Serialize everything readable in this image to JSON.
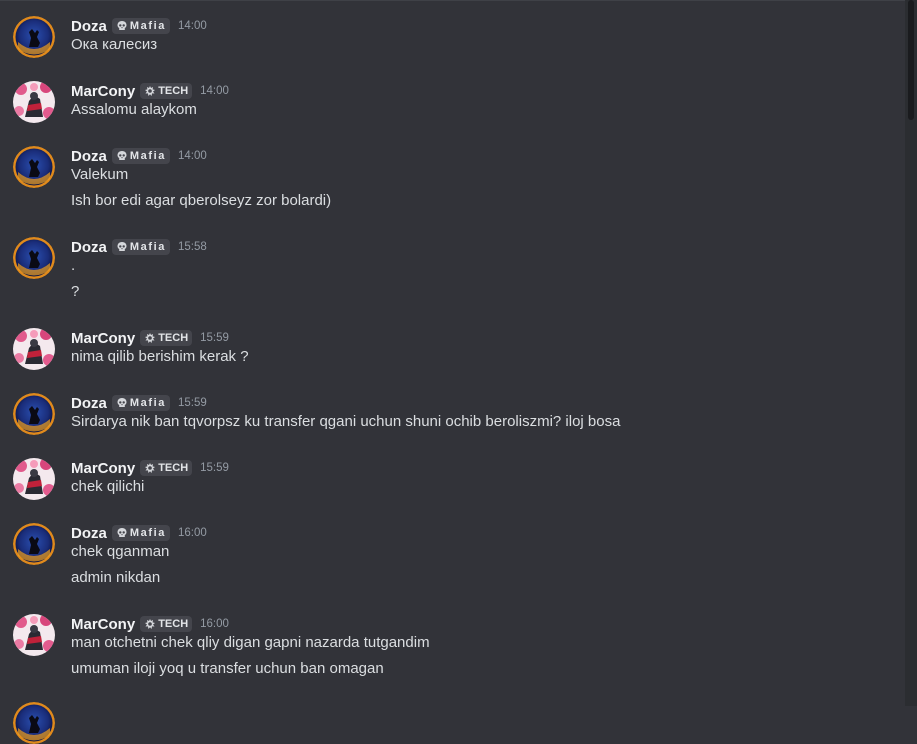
{
  "messages": [
    {
      "user": "Doza",
      "tag": "Mafia",
      "tag_icon": "skull-icon",
      "time": "14:00",
      "avatar": "doza",
      "lines": [
        "Ока калесиз"
      ]
    },
    {
      "user": "MarCony",
      "tag": "TECH",
      "tag_icon": "wrench-icon",
      "time": "14:00",
      "avatar": "marcony",
      "lines": [
        "Assalomu alaykom"
      ]
    },
    {
      "user": "Doza",
      "tag": "Mafia",
      "tag_icon": "skull-icon",
      "time": "14:00",
      "avatar": "doza",
      "lines": [
        "Valekum",
        "Ish bor edi agar qberolseyz zor bolardi)"
      ]
    },
    {
      "user": "Doza",
      "tag": "Mafia",
      "tag_icon": "skull-icon",
      "time": "15:58",
      "avatar": "doza",
      "lines": [
        ".",
        "?"
      ]
    },
    {
      "user": "MarCony",
      "tag": "TECH",
      "tag_icon": "wrench-icon",
      "time": "15:59",
      "avatar": "marcony",
      "lines": [
        "nima qilib berishim kerak ?"
      ]
    },
    {
      "user": "Doza",
      "tag": "Mafia",
      "tag_icon": "skull-icon",
      "time": "15:59",
      "avatar": "doza",
      "lines": [
        "Sirdarya nik ban tqvorpsz ku transfer qgani uchun shuni ochib beroliszmi? iloj bosa"
      ]
    },
    {
      "user": "MarCony",
      "tag": "TECH",
      "tag_icon": "wrench-icon",
      "time": "15:59",
      "avatar": "marcony",
      "lines": [
        "chek qilichi"
      ]
    },
    {
      "user": "Doza",
      "tag": "Mafia",
      "tag_icon": "skull-icon",
      "time": "16:00",
      "avatar": "doza",
      "lines": [
        "chek qganman",
        "admin nikdan"
      ]
    },
    {
      "user": "MarCony",
      "tag": "TECH",
      "tag_icon": "wrench-icon",
      "time": "16:00",
      "avatar": "marcony",
      "lines": [
        "man otchetni chek qliy digan gapni nazarda tutgandim",
        "umuman iloji yoq u transfer uchun ban omagan"
      ]
    }
  ],
  "colors": {
    "background": "#323339",
    "username": "#f2f3f5",
    "text": "#dbdee1",
    "time": "#949ba4",
    "tag_bg": "#44454c"
  }
}
